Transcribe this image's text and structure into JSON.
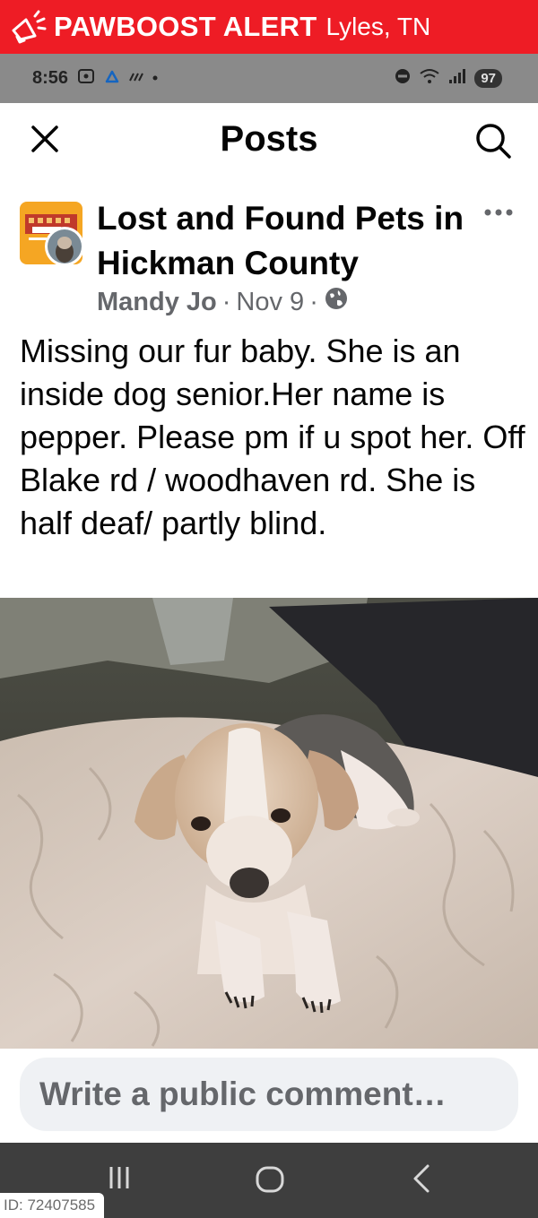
{
  "banner": {
    "title": "PAWBOOST ALERT",
    "location": "Lyles, TN",
    "bg_color": "#ee1c25"
  },
  "status_bar": {
    "time": "8:56",
    "icons": [
      "screenshot-icon",
      "cloud-icon",
      "signal-mute-icon",
      "dot-icon"
    ],
    "right_icons": [
      "dnd-icon",
      "wifi-icon",
      "cell-signal-icon"
    ],
    "battery": "97"
  },
  "header": {
    "title": "Posts",
    "left_icon": "close-icon",
    "right_icon": "search-icon"
  },
  "post": {
    "group_name": "Lost and Found Pets in Hickman County",
    "author": "Mandy Jo",
    "date": "Nov 9",
    "sep1": "·",
    "sep2": "·",
    "privacy_icon": "globe-icon",
    "text": "Missing our fur baby. She is an inside dog senior.Her name is pepper. Please pm if u spot her. Off Blake rd / woodhaven rd. She is half deaf/ partly blind."
  },
  "comment": {
    "placeholder": "Write a public comment…"
  },
  "nav": {
    "items": [
      "recent-apps-icon",
      "home-icon",
      "back-icon"
    ]
  },
  "id_tag": "ID: 72407585"
}
